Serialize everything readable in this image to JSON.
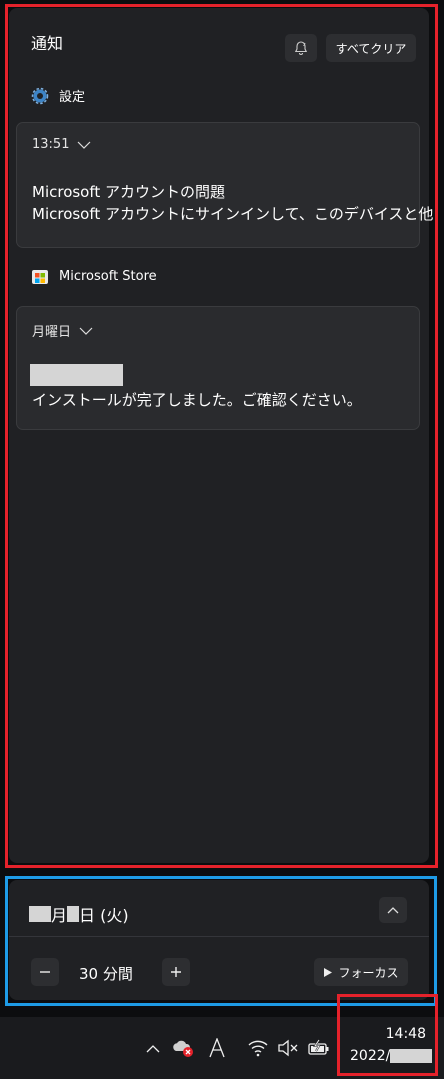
{
  "notification_center": {
    "title": "通知",
    "clear_all_label": "すべてクリア",
    "groups": [
      {
        "app": "設定",
        "time": "13:51",
        "title": "Microsoft アカウントの問題",
        "body": "Microsoft アカウントにサインインして、このデバイスと他"
      },
      {
        "app": "Microsoft Store",
        "time": "月曜日",
        "title": "",
        "body": "インストールが完了しました。ご確認ください。"
      }
    ]
  },
  "calendar": {
    "month_suffix": "月",
    "day_suffix": "日 (火)",
    "focus": {
      "duration": "30 分間",
      "focus_label": "フォーカス"
    }
  },
  "taskbar": {
    "clock_time": "14:48",
    "clock_date_prefix": "2022/"
  },
  "colors": {
    "annotation_red": "#e5222b",
    "annotation_blue": "#1e9be6",
    "panel_bg": "#202124"
  }
}
